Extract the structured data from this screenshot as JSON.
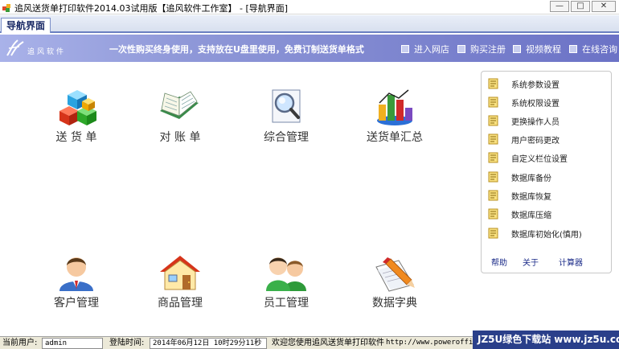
{
  "window": {
    "title": "追风送货单打印软件2014.03试用版【追风软件工作室】 - [导航界面]"
  },
  "tabs": [
    {
      "label": "导航界面"
    }
  ],
  "banner": {
    "company": "追风软件",
    "slogan": "一次性购买终身使用，支持放在U盘里使用，免费订制送货单格式",
    "links": [
      {
        "label": "进入网店"
      },
      {
        "label": "购买注册"
      },
      {
        "label": "视频教程"
      },
      {
        "label": "在线咨询"
      }
    ]
  },
  "modules": [
    {
      "label": "送 货 单",
      "icon": "cubes-icon"
    },
    {
      "label": "对 账 单",
      "icon": "open-book-icon"
    },
    {
      "label": "综合管理",
      "icon": "magnifier-icon"
    },
    {
      "label": "送货单汇总",
      "icon": "bar-chart-icon"
    },
    {
      "label": "客户管理",
      "icon": "customer-person-icon"
    },
    {
      "label": "商品管理",
      "icon": "house-icon"
    },
    {
      "label": "员工管理",
      "icon": "people-icon"
    },
    {
      "label": "数据字典",
      "icon": "pencil-notebook-icon"
    }
  ],
  "right_panel": {
    "items": [
      {
        "label": "系统参数设置"
      },
      {
        "label": "系统权限设置"
      },
      {
        "label": "更换操作人员"
      },
      {
        "label": "用户密码更改"
      },
      {
        "label": "自定义栏位设置"
      },
      {
        "label": "数据库备份"
      },
      {
        "label": "数据库恢复"
      },
      {
        "label": "数据库压缩"
      },
      {
        "label": "数据库初始化(慎用)"
      }
    ],
    "links": [
      {
        "label": "帮助"
      },
      {
        "label": "关于"
      },
      {
        "label": "计算器"
      }
    ]
  },
  "status": {
    "user_label": "当前用户:",
    "user_value": "admin",
    "login_label": "登陆时间:",
    "login_value": "2014年06月12日  10时29分11秒",
    "welcome": "欢迎您使用追风送货单打印软件",
    "url": "http://www.poweroffice"
  },
  "watermark": {
    "text": "JZ5U绿色下载站",
    "url": "www.jz5u.com"
  }
}
